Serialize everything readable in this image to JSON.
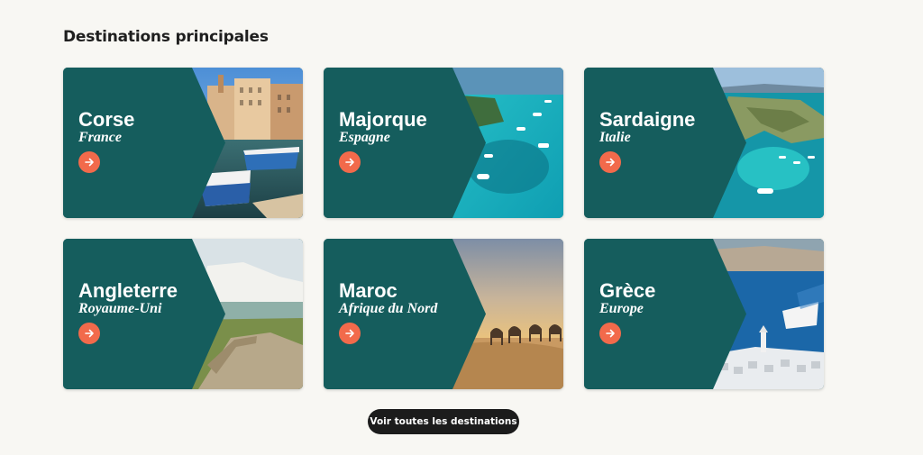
{
  "section": {
    "title": "Destinations principales"
  },
  "colors": {
    "panel": "#155d5d",
    "accent": "#f26a4b",
    "button": "#1c1c1c",
    "background": "#f8f7f3"
  },
  "destinations": [
    {
      "name": "Corse",
      "region": "France",
      "icon": "arrow-right-icon"
    },
    {
      "name": "Majorque",
      "region": "Espagne",
      "icon": "arrow-right-icon"
    },
    {
      "name": "Sardaigne",
      "region": "Italie",
      "icon": "arrow-right-icon"
    },
    {
      "name": "Angleterre",
      "region": "Royaume-Uni",
      "icon": "arrow-right-icon"
    },
    {
      "name": "Maroc",
      "region": "Afrique du Nord",
      "icon": "arrow-right-icon"
    },
    {
      "name": "Grèce",
      "region": "Europe",
      "icon": "arrow-right-icon"
    }
  ],
  "footer": {
    "see_all_label": "Voir toutes les destinations"
  }
}
